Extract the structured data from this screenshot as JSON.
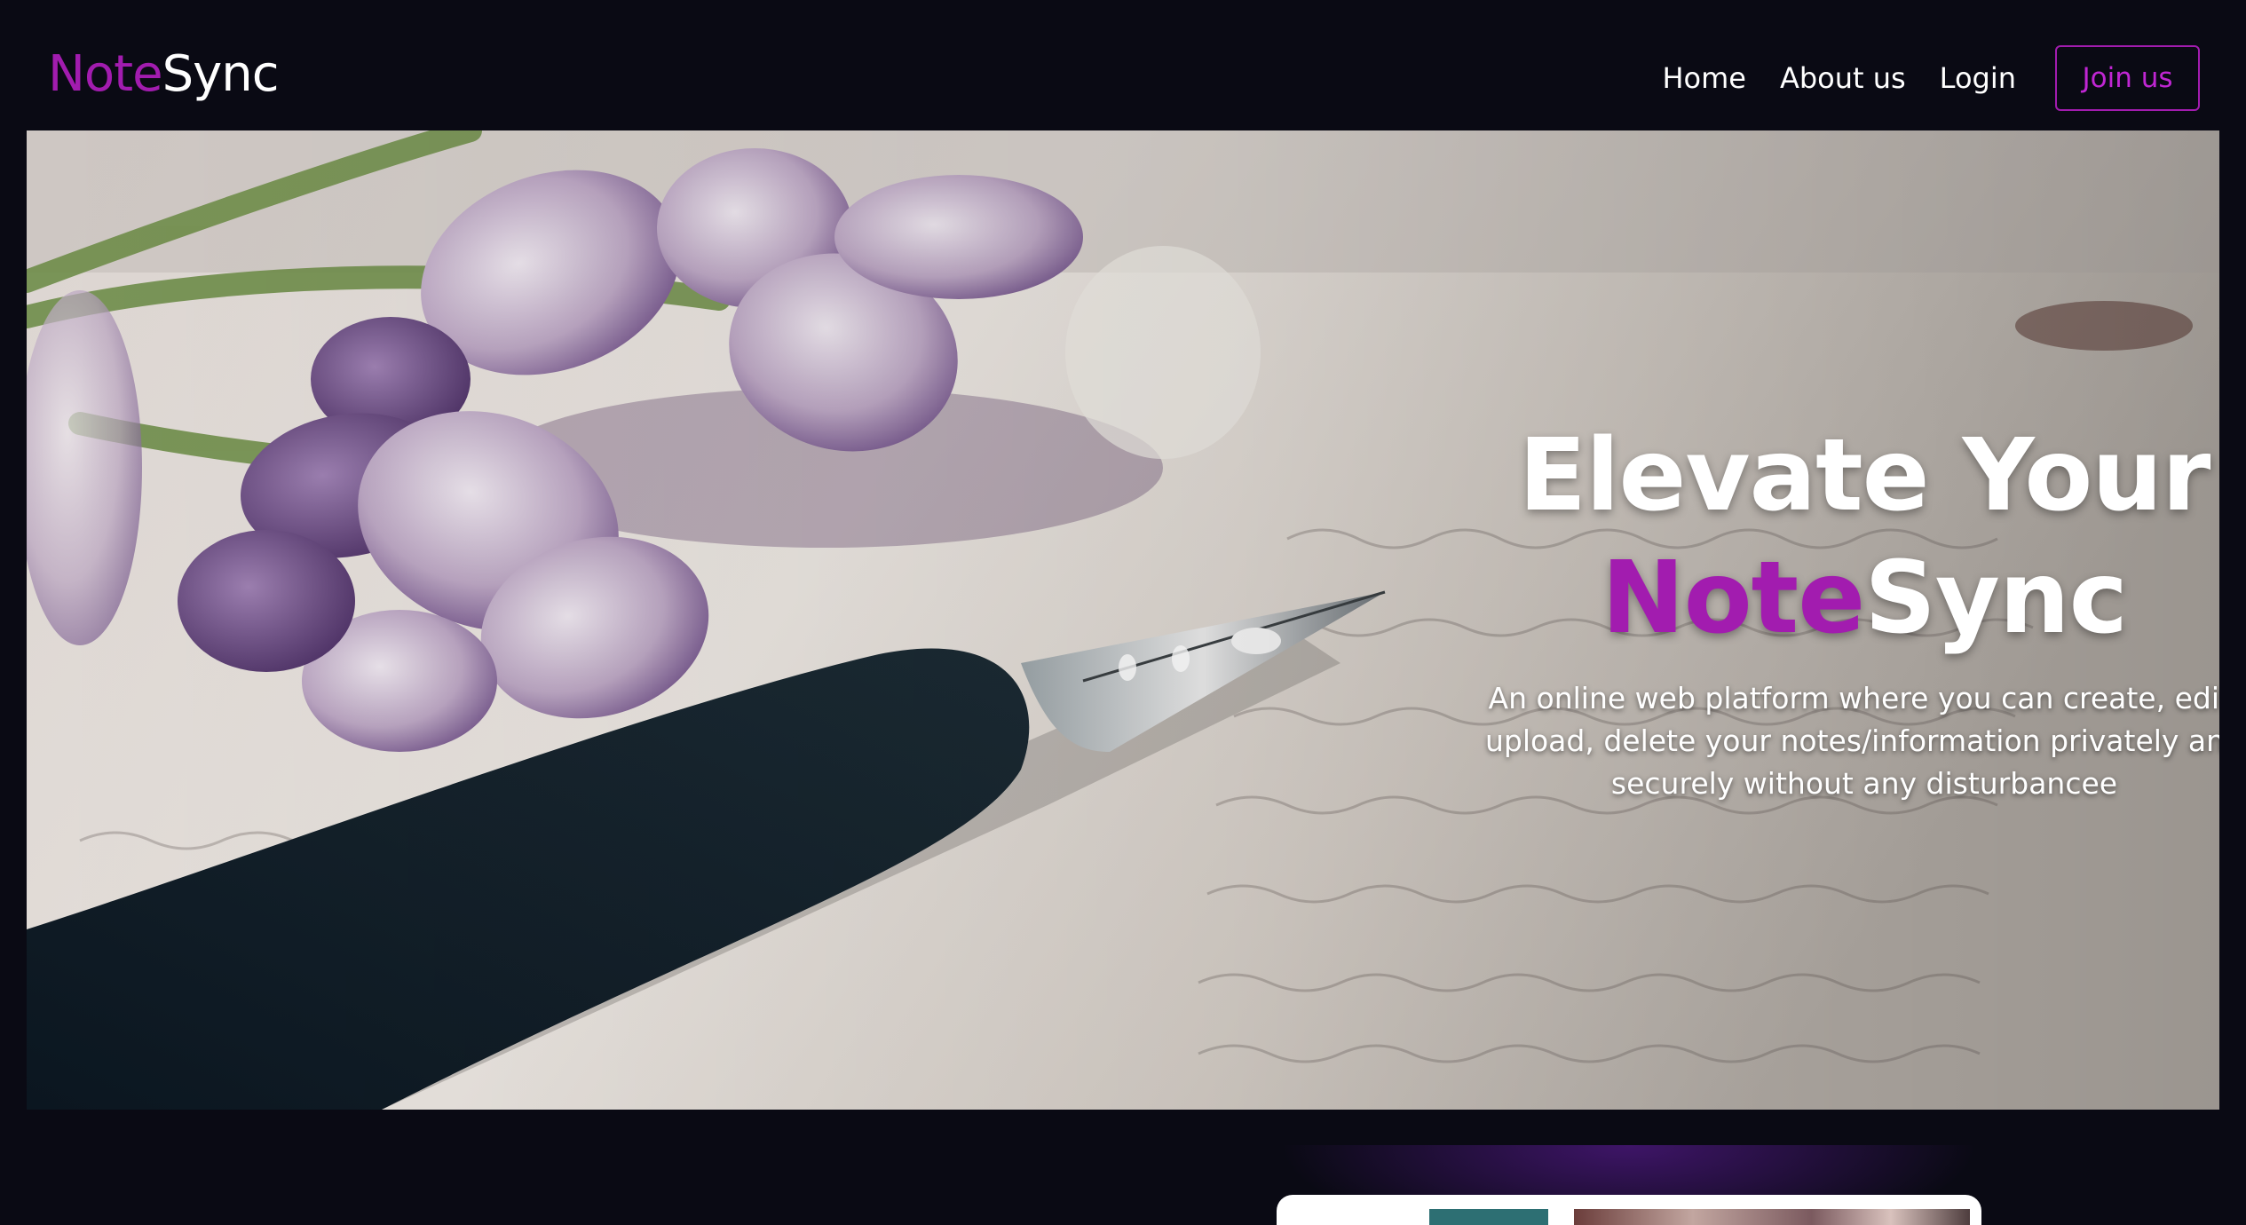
{
  "brand": {
    "accent": "Note",
    "rest": "Sync"
  },
  "nav": {
    "home": "Home",
    "about": "About us",
    "login": "Login",
    "join": "Join us"
  },
  "hero": {
    "title_line1": "Elevate Your",
    "title_accent": "Note",
    "title_rest": "Sync",
    "subtitle": "An online web platform where you can create, edit, upload, delete your notes/information privately and securely without any disturbancee"
  },
  "colors": {
    "background": "#0a0a14",
    "accent": "#a21caf",
    "text": "#ffffff"
  }
}
